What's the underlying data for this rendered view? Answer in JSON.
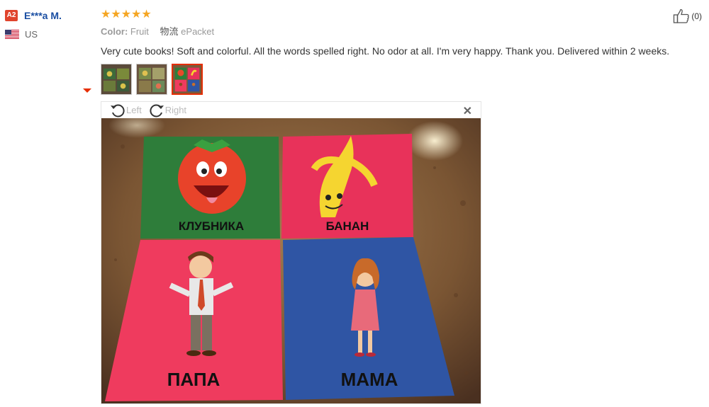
{
  "reviewer": {
    "level_badge": "A2",
    "name": "E***a M.",
    "country": "US",
    "flag_icon": "us-flag-icon"
  },
  "review": {
    "rating": 5,
    "stars": "★★★★★",
    "color_label": "Color:",
    "color_value": "Fruit",
    "shipping_label": "物流",
    "shipping_value": "ePacket",
    "text": "Very cute books! Soft and colorful. All the words spelled right. No odor at all. I'm very happy. Thank you. Delivered within 2 weeks.",
    "thumbnail_count": 3,
    "active_thumbnail": 3
  },
  "helpful": {
    "icon": "thumbs-up-icon",
    "count": "(0)"
  },
  "viewer": {
    "rotate_left_label": "Left",
    "rotate_right_label": "Right",
    "close_icon": "close-icon",
    "books": [
      {
        "word": "КЛУБНИКА",
        "color": "#2e7d3a",
        "picture": "strawberry"
      },
      {
        "word": "БАНАН",
        "color": "#e8325a",
        "picture": "banana"
      },
      {
        "word": "ПАПА",
        "color": "#ef3b5e",
        "picture": "dad"
      },
      {
        "word": "МАМА",
        "color": "#2f55a4",
        "picture": "mom"
      }
    ]
  },
  "colors": {
    "accent_red": "#e62e04",
    "star": "#f5a623",
    "name_blue": "#1a4ea2"
  }
}
